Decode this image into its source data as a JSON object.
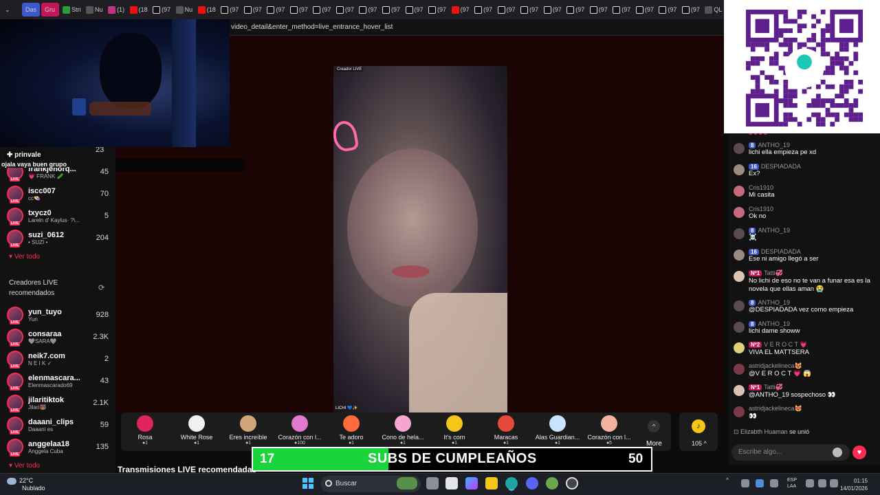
{
  "browser": {
    "tabs": [
      {
        "label": "Das",
        "icon": "group-icon",
        "group": true,
        "color": "#3f58c9"
      },
      {
        "label": "Gru",
        "icon": "group-icon",
        "group": true,
        "color": "#c2185b"
      },
      {
        "label": "Stri",
        "icon": "sheets-icon"
      },
      {
        "label": "Nu",
        "icon": "page-icon"
      },
      {
        "label": "(1)",
        "icon": "instagram-icon"
      },
      {
        "label": "(18",
        "icon": "youtube-icon"
      },
      {
        "label": "(97",
        "icon": "tiktok-icon"
      },
      {
        "label": "Nu",
        "icon": "page-icon"
      },
      {
        "label": "(18",
        "icon": "youtube-icon"
      },
      {
        "label": "(97",
        "icon": "tiktok-icon"
      },
      {
        "label": "(97",
        "icon": "tiktok-icon"
      },
      {
        "label": "(97",
        "icon": "tiktok-icon"
      },
      {
        "label": "(97",
        "icon": "tiktok-icon"
      },
      {
        "label": "(97",
        "icon": "tiktok-icon"
      },
      {
        "label": "(97",
        "icon": "tiktok-icon"
      },
      {
        "label": "(97",
        "icon": "tiktok-icon"
      },
      {
        "label": "(97",
        "icon": "tiktok-icon"
      },
      {
        "label": "(97",
        "icon": "tiktok-icon"
      },
      {
        "label": "(97",
        "icon": "tiktok-icon"
      },
      {
        "label": "(97",
        "icon": "youtube-icon"
      },
      {
        "label": "(97",
        "icon": "tiktok-icon"
      },
      {
        "label": "(97",
        "icon": "tiktok-icon"
      },
      {
        "label": "(97",
        "icon": "tiktok-icon"
      },
      {
        "label": "(97",
        "icon": "tiktok-icon"
      },
      {
        "label": "(97",
        "icon": "tiktok-icon"
      },
      {
        "label": "(97",
        "icon": "tiktok-icon"
      },
      {
        "label": "(97",
        "icon": "tiktok-icon"
      },
      {
        "label": "(97",
        "icon": "tiktok-icon"
      },
      {
        "label": "(97",
        "icon": "tiktok-icon"
      },
      {
        "label": "(97",
        "icon": "tiktok-icon"
      },
      {
        "label": "QL",
        "icon": "search-icon"
      }
    ],
    "url": "video_detail&enter_method=live_entrance_hover_list"
  },
  "overlay": {
    "prinvale": "✚ prinvale",
    "ojala": "ojala vaya buen grupo"
  },
  "sidebar": {
    "following": [
      {
        "name": "frankjehorq...",
        "sub": "💗 FRANK 🥒",
        "count": "45"
      },
      {
        "name": "iscc007",
        "sub": "cc👒",
        "count": "70"
      },
      {
        "name": "txycz0",
        "sub": "Lareln d' Kaylus· ?\\...",
        "count": "5"
      },
      {
        "name": "suzi_0612",
        "sub": "• SUZI •",
        "count": "204"
      }
    ],
    "partial_count": "23",
    "see_all": "Ver todo",
    "recommended_title": "Creadores LIVE recomendados",
    "recommended": [
      {
        "name": "yun_tuyo",
        "sub": "Yun",
        "count": "928"
      },
      {
        "name": "consaraa",
        "sub": "🩶SARA🩶",
        "count": "2.3K"
      },
      {
        "name": "neik7.com",
        "sub": "N E I K ✓",
        "count": "2"
      },
      {
        "name": "elenmascara...",
        "sub": "Elenmascarado69",
        "count": "43"
      },
      {
        "name": "jilaritiktok",
        "sub": "Jilari🐻",
        "count": "2.1K"
      },
      {
        "name": "daaani_clips",
        "sub": "Daaani es",
        "count": "59"
      },
      {
        "name": "anggelaa18",
        "sub": "Anggela Cuba",
        "count": "135"
      }
    ],
    "see_all_2": "Ver todo"
  },
  "video": {
    "tag": "Creador LIVE",
    "name": "LICHI 💙✨"
  },
  "gifts": [
    {
      "label": "Rosa",
      "cost": "●1",
      "color": "#e0245e"
    },
    {
      "label": "White Rose",
      "cost": "●1",
      "color": "#f0f0f0"
    },
    {
      "label": "Eres increíble",
      "cost": "●1",
      "color": "#d2a679"
    },
    {
      "label": "Corazón con l...",
      "cost": "●100",
      "color": "#e07ad0"
    },
    {
      "label": "Te adoro",
      "cost": "●1",
      "color": "#ff6a3d"
    },
    {
      "label": "Cono de hela...",
      "cost": "●1",
      "color": "#f4a6d0"
    },
    {
      "label": "It's corn",
      "cost": "●1",
      "color": "#f5c518"
    },
    {
      "label": "Maracas",
      "cost": "●1",
      "color": "#e84a3a"
    },
    {
      "label": "Alas Guardian...",
      "cost": "●1",
      "color": "#c9e4ff"
    },
    {
      "label": "Corazón con l...",
      "cost": "●5",
      "color": "#f2b2a0"
    }
  ],
  "gift_more": "More",
  "coins": "105 ^",
  "subs_banner": {
    "start": "17",
    "title": "SUBS DE CUMPLEAÑOS",
    "goal": "50",
    "progress": 0.34,
    "fill_color": "#19d43a"
  },
  "recommended_heading": "Transmisiones LIVE recomendadas",
  "chat": {
    "messages": [
      {
        "user": "ANTHO_19",
        "badge": "8",
        "badge_color": "blue",
        "text": "lichi ella empieza pe xd",
        "av": "#5b4a52"
      },
      {
        "user": "DESPIADADA",
        "badge": "16",
        "badge_color": "blue",
        "text": "Ex?",
        "av": "#9a8a80"
      },
      {
        "user": "Cris1910",
        "badge": "",
        "badge_color": "",
        "text": "Mi casita",
        "av": "#c46a7a"
      },
      {
        "user": "Cris1910",
        "badge": "",
        "badge_color": "",
        "text": "Ok no",
        "av": "#c46a7a"
      },
      {
        "user": "ANTHO_19",
        "badge": "8",
        "badge_color": "blue",
        "text": "☠️",
        "av": "#5b4a52"
      },
      {
        "user": "DESPIADADA",
        "badge": "16",
        "badge_color": "blue",
        "text": "Ese ni amigo llegó a ser",
        "av": "#9a8a80"
      },
      {
        "user": "Tatti💞",
        "badge": "Nº1",
        "badge_color": "red",
        "text": "No lichi de eso no te van a funar esa es la novela que ellas aman 😭",
        "av": "#d9c3b5"
      },
      {
        "user": "ANTHO_19",
        "badge": "8",
        "badge_color": "blue",
        "text": "@DESPIADADA vez como empieza",
        "av": "#5b4a52"
      },
      {
        "user": "ANTHO_19",
        "badge": "8",
        "badge_color": "blue",
        "text": "lichi dame showw",
        "av": "#5b4a52"
      },
      {
        "user": "V E R O C T 💗",
        "badge": "Nº2",
        "badge_color": "red",
        "text": "VIVA EL MATTSERA",
        "av": "#e0d07a"
      },
      {
        "user": "astridjackelineca😻",
        "badge": "",
        "badge_color": "",
        "text": "@V E R O C T 💗 😱",
        "av": "#7a3a4a"
      },
      {
        "user": "Tatti💞",
        "badge": "Nº1",
        "badge_color": "red",
        "text": "@ANTHO_19 sospechoso 👀",
        "av": "#d9c3b5"
      },
      {
        "user": "astridjackelineca😻",
        "badge": "",
        "badge_color": "",
        "text": "👀",
        "av": "#7a3a4a"
      }
    ],
    "joined_user": "Elizabth Huaman",
    "joined_text": "se unió",
    "input_placeholder": "Escribe algo..."
  },
  "taskbar": {
    "temp": "22°C",
    "weather": "Nublado",
    "search": "Buscar",
    "lang1": "ESP",
    "lang2": "LAA",
    "time": "01:15",
    "date": "14/01/2026"
  }
}
